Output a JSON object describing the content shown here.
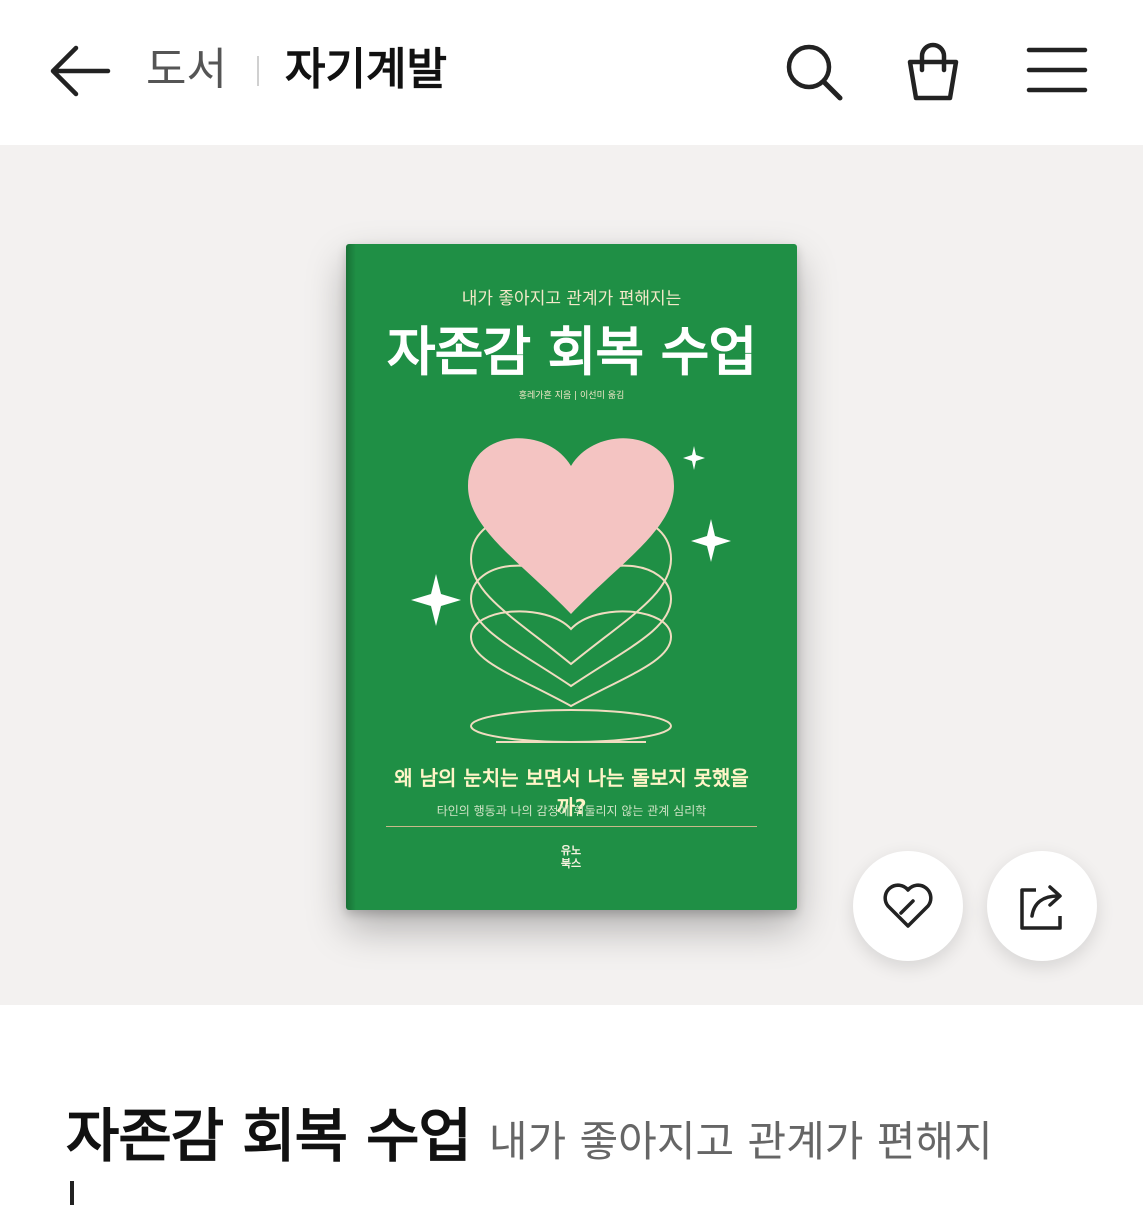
{
  "header": {
    "breadcrumb_category": "도서",
    "breadcrumb_current": "자기계발"
  },
  "book": {
    "cover_subtitle": "내가 좋아지고 관계가 편해지는",
    "cover_title": "자존감 회복 수업",
    "cover_author": "홍레가흔 지음 | 이선미 옮김",
    "cover_question": "왜 남의 눈치는 보면서 나는 돌보지 못했을까?",
    "cover_tagline": "타인의 행동과 나의 감정에 휘둘리지 않는 관계 심리학",
    "cover_publisher_line1": "유노",
    "cover_publisher_line2": "북스",
    "colors": {
      "cover_green": "#1f8f45",
      "heart_pink": "#f4c4c2",
      "line_cream": "#f0dcc0"
    }
  },
  "product": {
    "title": "자존감 회복 수업",
    "subtitle": "내가 좋아지고 관계가 편해지"
  },
  "icons": [
    "back-arrow-icon",
    "search-icon",
    "shopping-bag-icon",
    "hamburger-menu-icon",
    "heart-like-icon",
    "share-icon"
  ]
}
